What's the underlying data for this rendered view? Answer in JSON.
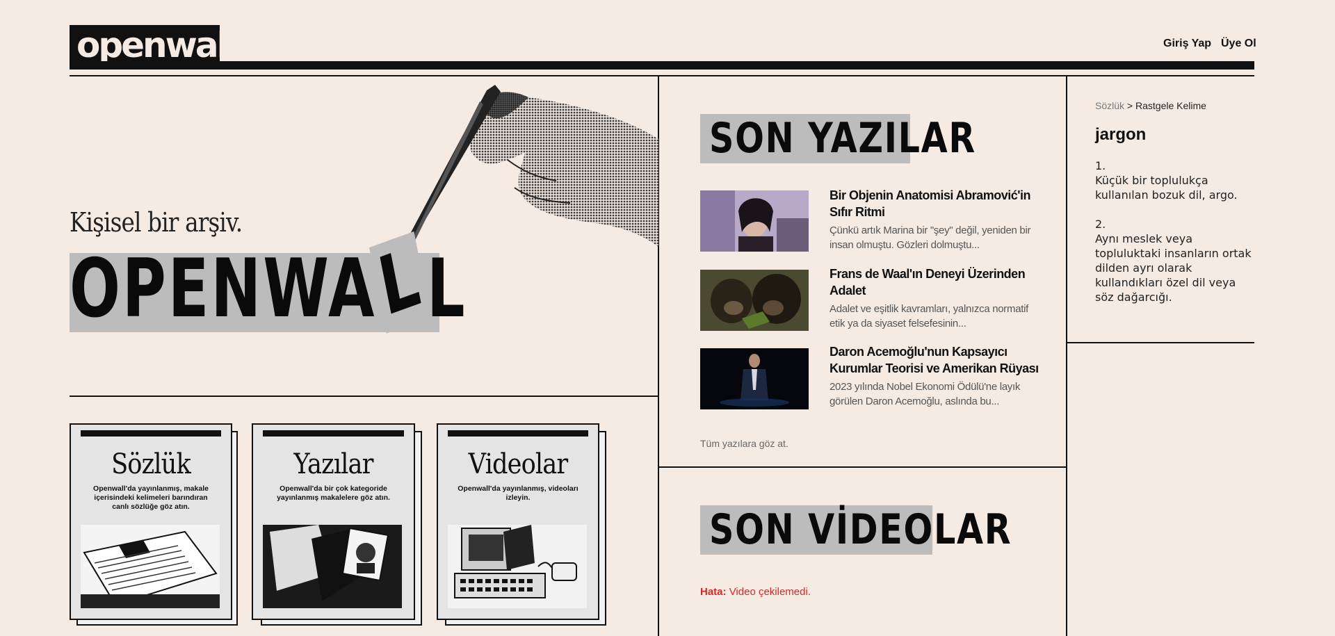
{
  "header": {
    "logo": "openwall",
    "nav": {
      "login": "Giriş Yap",
      "signup": "Üye Ol"
    }
  },
  "hero": {
    "subtitle": "Kişisel bir arşiv.",
    "title": "OPENWALL",
    "title_parts": [
      "OPENWA",
      "L",
      "L"
    ]
  },
  "cards": [
    {
      "title": "Sözlük",
      "desc": "Openwall'da yayınlanmış, makale içerisindeki kelimeleri barındıran canlı sözlüğe göz atın.",
      "art": "newspaper-illustration"
    },
    {
      "title": "Yazılar",
      "desc": "Openwall'da bir çok kategoride yayınlanmış makalelere göz atın.",
      "art": "documents-portrait-illustration"
    },
    {
      "title": "Videolar",
      "desc": "Openwall'da yayınlanmış, videoları izleyin.",
      "art": "retro-computer-illustration"
    }
  ],
  "latest_posts": {
    "heading": "SON YAZILAR",
    "items": [
      {
        "title": "Bir Objenin Anatomisi Abramović'in Sıfır Ritmi",
        "excerpt": "Çünkü artık Marina bir \"şey\" değil, yeniden bir insan olmuştu. Gözleri dolmuştu..."
      },
      {
        "title": "Frans de Waal'ın Deneyi Üzerinden Adalet",
        "excerpt": "Adalet ve eşitlik kavramları, yalnızca normatif etik ya da siyaset felsefesinin..."
      },
      {
        "title": "Daron Acemoğlu'nun Kapsayıcı Kurumlar Teorisi ve Amerikan Rüyası",
        "excerpt": "2023 yılında Nobel Ekonomi Ödülü'ne layık görülen Daron Acemoğlu, aslında bu..."
      }
    ],
    "all_link": "Tüm yazılara göz at."
  },
  "latest_videos": {
    "heading": "SON VİDEOLAR",
    "error_label": "Hata:",
    "error_message": "Video çekilemedi."
  },
  "dictionary": {
    "breadcrumb_root": "Sözlük",
    "breadcrumb_sep": ">",
    "breadcrumb_current": "Rastgele Kelime",
    "word": "jargon",
    "definitions": [
      {
        "num": "1.",
        "text": "Küçük bir toplulukça kullanılan bozuk dil, argo."
      },
      {
        "num": "2.",
        "text": "Aynı meslek veya topluluktaki insanların ortak dilden ayrı olarak kullandıkları özel dil veya söz dağarcığı."
      }
    ]
  },
  "colors": {
    "background": "#f6ebe3",
    "ink": "#111111",
    "highlight": "#bdbcbd",
    "error": "#d62828"
  }
}
